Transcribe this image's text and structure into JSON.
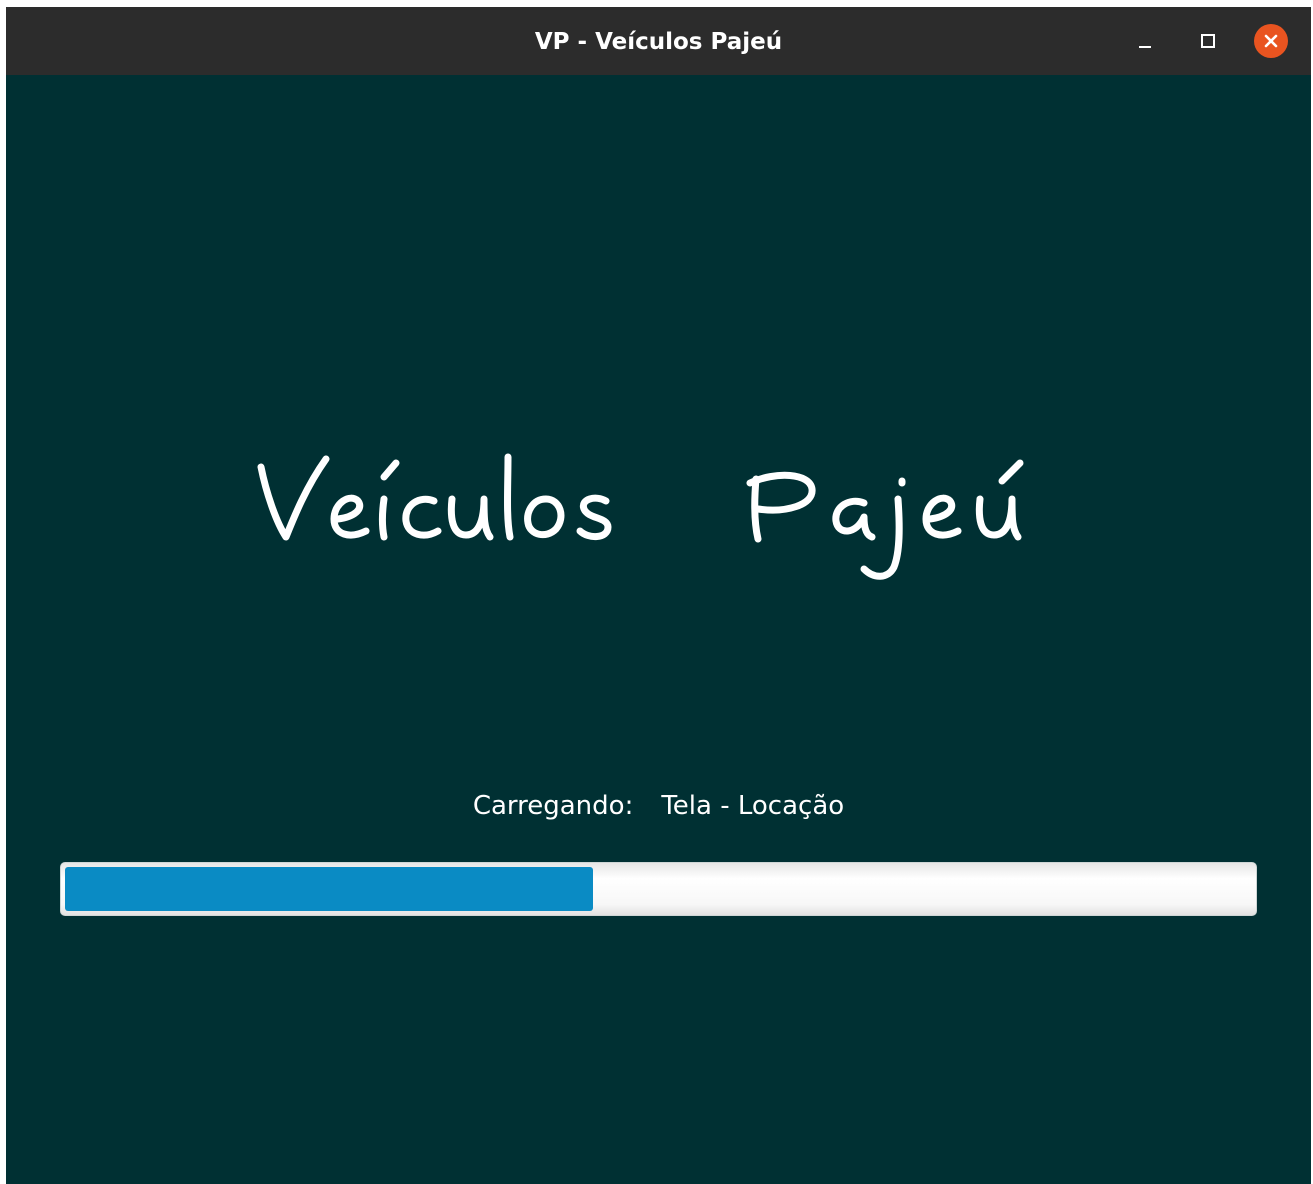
{
  "window": {
    "title": "VP - Veículos Pajeú",
    "controls": {
      "minimize": "minimize-icon",
      "maximize": "maximize-icon",
      "close": "close-icon"
    },
    "close_color": "#e95420"
  },
  "splash": {
    "logo_text": "Veículos Pajeú",
    "background_color": "#003033",
    "status_label": "Carregando:",
    "status_value": "Tela - Locação",
    "progress": 0.445,
    "progress_color": "#0a8bc4"
  }
}
